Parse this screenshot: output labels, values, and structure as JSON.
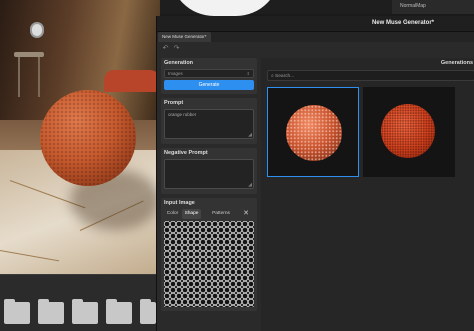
{
  "window": {
    "title": "New Muse Generator*",
    "tab_label": "New Muse Generator*"
  },
  "other_window": {
    "tab_label": "NormalMap"
  },
  "generation": {
    "title": "Generation",
    "type_value": "Images",
    "generate_label": "Generate"
  },
  "prompt": {
    "title": "Prompt",
    "value": "orange rubber"
  },
  "negative_prompt": {
    "title": "Negative Prompt",
    "value": ""
  },
  "input_image": {
    "title": "Input Image",
    "modes": [
      "Color",
      "Shape",
      "Patterns"
    ],
    "active_mode": "Shape"
  },
  "generations": {
    "title": "Generations",
    "search_placeholder": "Search..."
  },
  "colors": {
    "accent": "#2d8ff0",
    "panel": "#333333",
    "background": "#2a2a2a"
  }
}
